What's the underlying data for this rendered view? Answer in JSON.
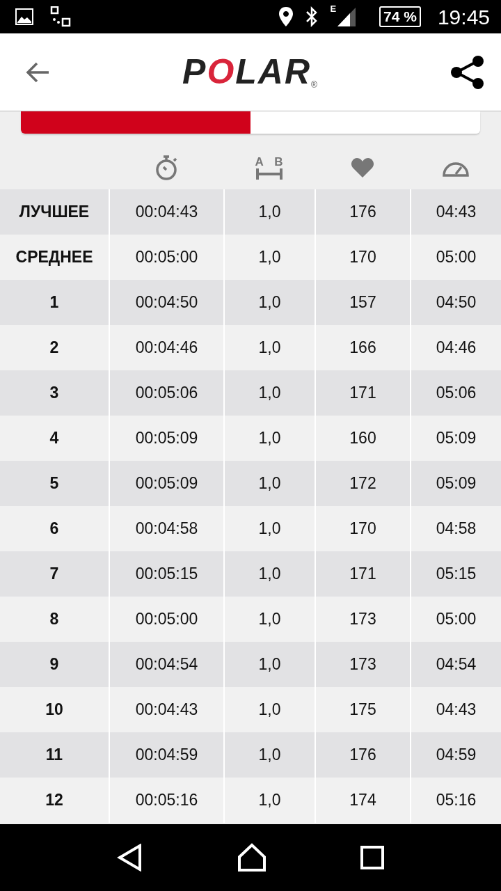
{
  "status_bar": {
    "network": "E",
    "battery": "74 %",
    "time": "19:45"
  },
  "header": {
    "logo": "POLAR",
    "logo_mark": "®"
  },
  "tabs": [
    {
      "selected": true
    },
    {
      "selected": false
    }
  ],
  "columns": [
    {
      "kind": "stopwatch"
    },
    {
      "kind": "distance",
      "label_a": "A",
      "label_b": "B"
    },
    {
      "kind": "heart"
    },
    {
      "kind": "gauge"
    }
  ],
  "rows": [
    {
      "label": "ЛУЧШЕЕ",
      "cells": [
        "00:04:43",
        "1,0",
        "176",
        "04:43"
      ]
    },
    {
      "label": "СРЕДНЕЕ",
      "cells": [
        "00:05:00",
        "1,0",
        "170",
        "05:00"
      ]
    },
    {
      "label": "1",
      "cells": [
        "00:04:50",
        "1,0",
        "157",
        "04:50"
      ]
    },
    {
      "label": "2",
      "cells": [
        "00:04:46",
        "1,0",
        "166",
        "04:46"
      ]
    },
    {
      "label": "3",
      "cells": [
        "00:05:06",
        "1,0",
        "171",
        "05:06"
      ]
    },
    {
      "label": "4",
      "cells": [
        "00:05:09",
        "1,0",
        "160",
        "05:09"
      ]
    },
    {
      "label": "5",
      "cells": [
        "00:05:09",
        "1,0",
        "172",
        "05:09"
      ]
    },
    {
      "label": "6",
      "cells": [
        "00:04:58",
        "1,0",
        "170",
        "04:58"
      ]
    },
    {
      "label": "7",
      "cells": [
        "00:05:15",
        "1,0",
        "171",
        "05:15"
      ]
    },
    {
      "label": "8",
      "cells": [
        "00:05:00",
        "1,0",
        "173",
        "05:00"
      ]
    },
    {
      "label": "9",
      "cells": [
        "00:04:54",
        "1,0",
        "173",
        "04:54"
      ]
    },
    {
      "label": "10",
      "cells": [
        "00:04:43",
        "1,0",
        "175",
        "04:43"
      ]
    },
    {
      "label": "11",
      "cells": [
        "00:04:59",
        "1,0",
        "176",
        "04:59"
      ]
    },
    {
      "label": "12",
      "cells": [
        "00:05:16",
        "1,0",
        "174",
        "05:16"
      ]
    }
  ]
}
